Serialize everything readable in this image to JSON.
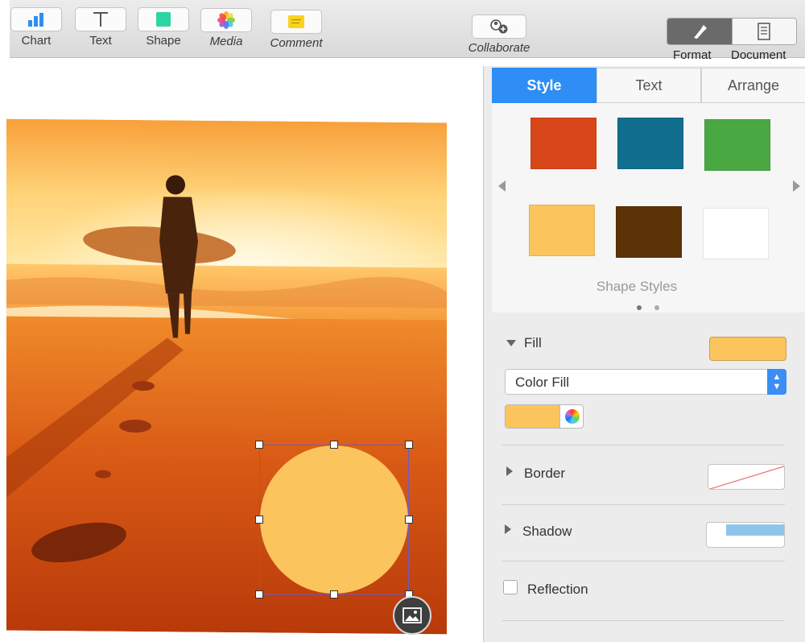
{
  "toolbar": {
    "chart": "Chart",
    "text": "Text",
    "shape": "Shape",
    "media": "Media",
    "comment": "Comment",
    "collaborate": "Collaborate",
    "format": "Format",
    "document": "Document"
  },
  "inspector": {
    "tabs": [
      "Style",
      "Text",
      "Arrange"
    ],
    "shape_styles_label": "Shape Styles",
    "swatches": [
      "#d8461a",
      "#116e8f",
      "#4aa843",
      "#fcc45d",
      "#5b3306",
      "#ffffff"
    ],
    "fill": {
      "label": "Fill",
      "color": "#fcc45d",
      "type": "Color Fill"
    },
    "border_label": "Border",
    "shadow_label": "Shadow",
    "reflection_label": "Reflection"
  },
  "canvas": {
    "circle_color": "#fcc45d"
  }
}
